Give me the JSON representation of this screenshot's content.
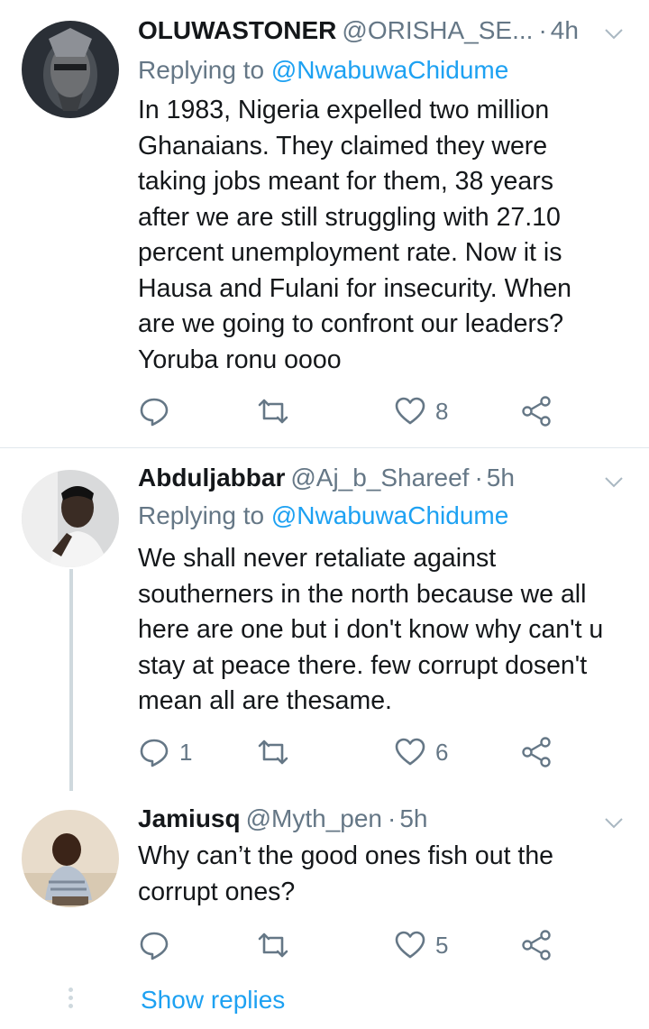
{
  "tweets": [
    {
      "name": "OLUWASTONER",
      "handle": "@ORISHA_SE...",
      "dot": "·",
      "time": "4h",
      "replying_prefix": "Replying to",
      "replying_to": "@NwabuwaChidume",
      "text": "In 1983, Nigeria expelled two million\nGhanaians. They claimed they were\ntaking jobs meant for them, 38 years\nafter we are still struggling with 27.10\npercent unemployment rate. Now it is\nHausa and Fulani for insecurity. When\nare we going to confront our leaders?\nYoruba ronu oooo",
      "replies": "",
      "retweets": "",
      "likes": "8"
    },
    {
      "name": "Abduljabbar",
      "handle": "@Aj_b_Shareef",
      "dot": "·",
      "time": "5h",
      "replying_prefix": "Replying to",
      "replying_to": "@NwabuwaChidume",
      "text": "We shall never retaliate against\nsoutherners in the north because we all\nhere are one but i don't know why can't u\nstay at peace there. few corrupt dosen't\nmean all are thesame.",
      "replies": "1",
      "retweets": "",
      "likes": "6"
    },
    {
      "name": "Jamiusq",
      "handle": "@Myth_pen",
      "dot": "·",
      "time": "5h",
      "text": "Why can’t the good ones fish out the\ncorrupt ones?",
      "replies": "",
      "retweets": "",
      "likes": "5"
    }
  ],
  "show_replies": "Show replies",
  "colors": {
    "accent": "#1da1f2",
    "secondary": "#657786",
    "text": "#14171a",
    "divider": "#e1e8ed"
  },
  "icons": [
    "reply-icon",
    "retweet-icon",
    "like-icon",
    "share-icon",
    "caret-down-icon"
  ]
}
